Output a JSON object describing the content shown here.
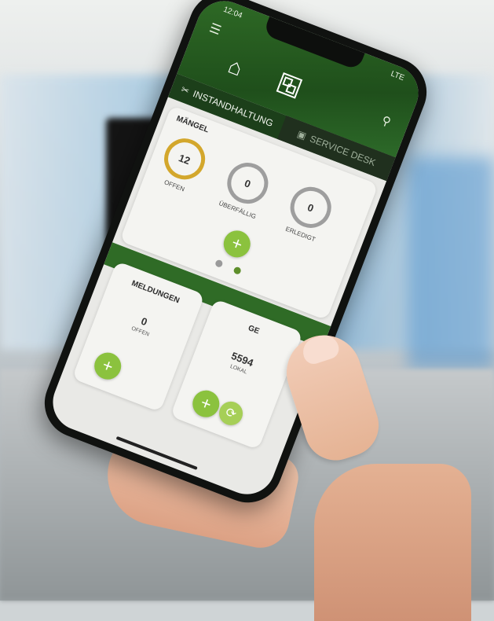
{
  "status_bar": {
    "time": "12:04",
    "network": "LTE"
  },
  "tabs": [
    {
      "label": "INSTANDHALTUNG",
      "active": true
    },
    {
      "label": "SERVICE DESK",
      "active": false
    }
  ],
  "maengel": {
    "title": "MÄNGEL",
    "stats": [
      {
        "value": "12",
        "label": "OFFEN",
        "color": "#d3a72c"
      },
      {
        "value": "0",
        "label": "ÜBERFÄLLIG",
        "color": "#9e9e9e"
      },
      {
        "value": "0",
        "label": "ERLEDIGT",
        "color": "#9e9e9e"
      }
    ],
    "add_label": "+"
  },
  "meldungen": {
    "title": "MELDUNGEN",
    "value": "0",
    "label": "OFFEN",
    "add_label": "+"
  },
  "geraete": {
    "title": "GE",
    "value": "5594",
    "label": "LOKAL",
    "add_label": "+",
    "sync_label": "⟳"
  },
  "icons": {
    "menu": "menu-icon",
    "home": "home-icon",
    "qr": "qr-code-icon",
    "search": "search-icon"
  },
  "colors": {
    "brand_green": "#2f6b26",
    "accent_green": "#8bc23e",
    "open_ring": "#d3a72c"
  }
}
